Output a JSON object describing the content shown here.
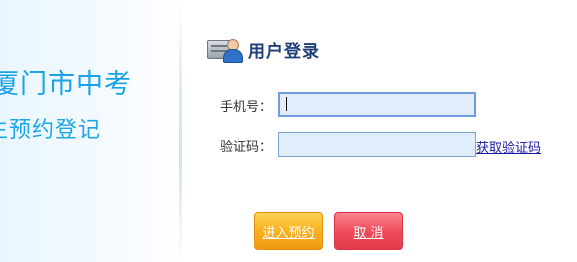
{
  "left_panel": {
    "title_line1": "厦门市中考",
    "title_line2": "生预约登记"
  },
  "login": {
    "title": "用户登录",
    "icon": "user-card-icon",
    "phone_label": "手机号：",
    "phone_value": "",
    "code_label": "验证码：",
    "code_value": "",
    "get_code_link": "获取验证码"
  },
  "buttons": {
    "submit": "进入预约",
    "cancel": "取 消"
  },
  "colors": {
    "brand_blue": "#19a3e6",
    "title_navy": "#1e3f7a",
    "submit_orange": "#f7a51c",
    "cancel_red": "#e9404f"
  }
}
